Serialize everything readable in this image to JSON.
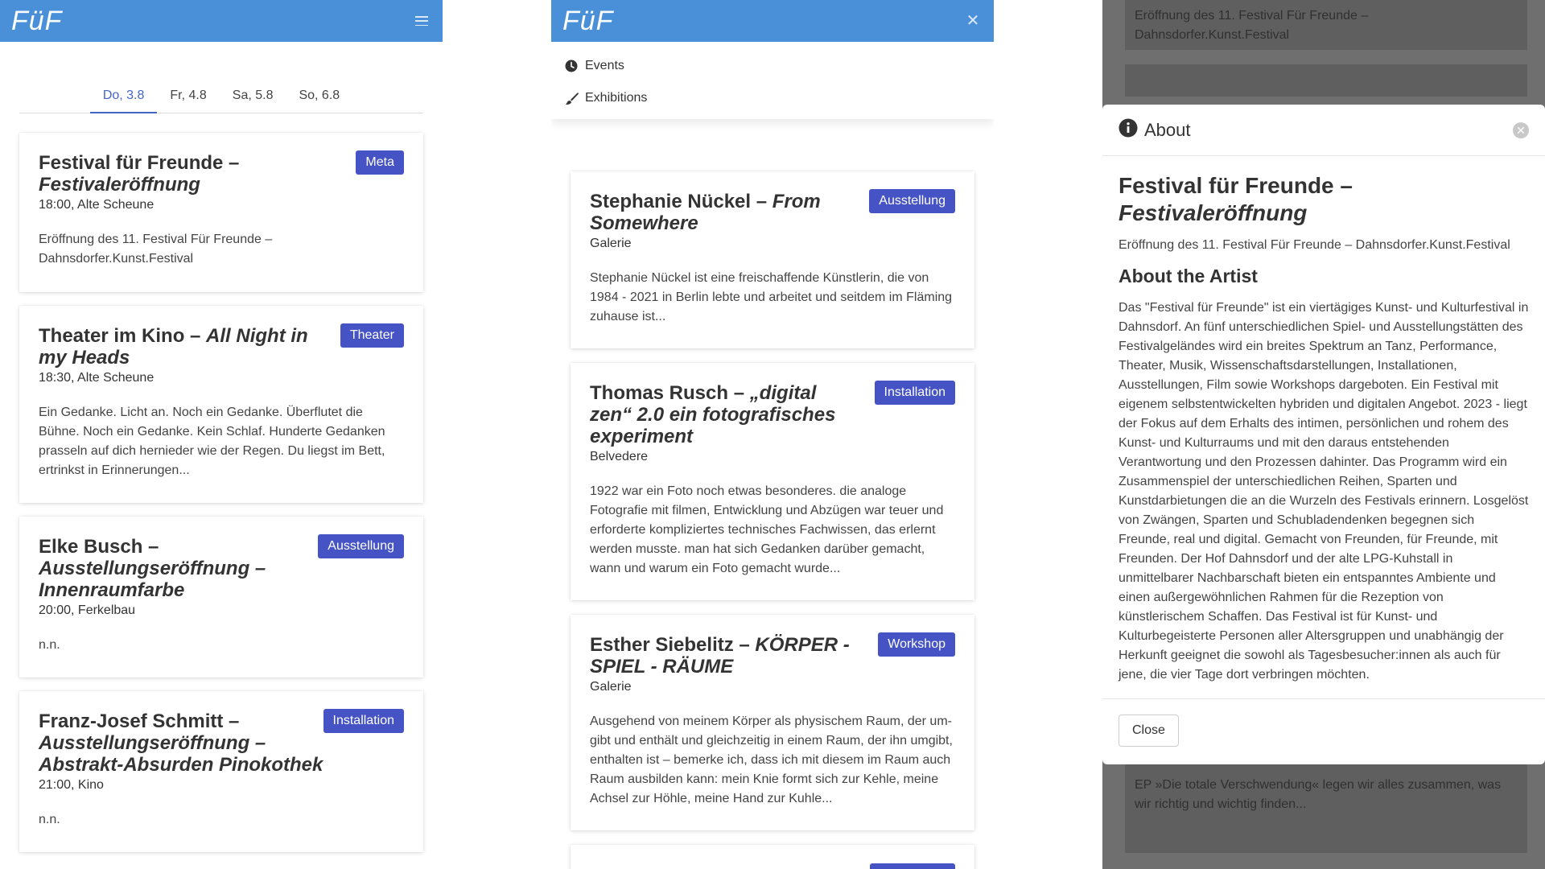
{
  "brand": {
    "logo": "FüF"
  },
  "days": [
    "Do, 3.8",
    "Fr, 4.8",
    "Sa, 5.8",
    "So, 6.8"
  ],
  "events": [
    {
      "title_main": "Festival für Freunde – ",
      "title_italic": "Festivaleröffnung",
      "meta": "18:00, Alte Scheune",
      "desc": "Eröffnung des 11. Festival Für Freunde – Dahnsdorfer.Kunst.Festival",
      "badge": "Meta"
    },
    {
      "title_main": "Theater im Kino – ",
      "title_italic": "All Night in my Heads",
      "meta": "18:30, Alte Scheune",
      "desc": "Ein Gedanke. Licht an. Noch ein Gedanke. Überflutet die Bühne. Noch ein Gedanke. Kein Schlaf. Hunderte Gedanken prasseln auf dich hernieder wie der Regen. Du liegst im Bett, ertrinkst in Erinnerungen...",
      "badge": "Theater"
    },
    {
      "title_main": "Elke Busch – ",
      "title_italic": "Ausstellungseröffnung – Innenraumfarbe",
      "meta": "20:00, Ferkelbau",
      "desc": "n.n.",
      "badge": "Ausstellung"
    },
    {
      "title_main": "Franz-Josef Schmitt – ",
      "title_italic": "Ausstellungseröffnung – Abstrakt-Absurden Pinokothek",
      "meta": "21:00, Kino",
      "desc": "n.n.",
      "badge": "Installation"
    }
  ],
  "menu": {
    "events": "Events",
    "exhibitions": "Exhibitions"
  },
  "exhibitions": [
    {
      "title_main": "Stephanie Nückel – ",
      "title_italic": "From Somewhere",
      "meta": "Galerie",
      "desc": "Stephanie Nückel ist eine freischaffende Künstlerin, die von 1984 - 2021 in Berlin lebte und arbeitet und seitdem im Fläming zuhause ist...",
      "badge": "Ausstellung"
    },
    {
      "title_main": "Thomas Rusch – ",
      "title_italic": "„digital zen“ 2.0 ein fotografisches experiment",
      "meta": "Belvedere",
      "desc": "1922 war ein Foto noch etwas besonderes. die analoge Fotografie mit filmen, Entwicklung und Abzügen war teuer und erforderte kompliziertes technisches Fachwissen, das erlernt werden musste. man hat sich Gedanken darüber gemacht, wann und warum ein Foto gemacht wurde...",
      "badge": "Installation"
    },
    {
      "title_main": "Esther Siebelitz – ",
      "title_italic": "KÖRPER - SPIEL - RÄUME",
      "meta": "Galerie",
      "desc": "Ausgehend von meinem Körper als physischem Raum, der um- gibt und enthält und gleichzeitig in einem Raum, der ihn umgibt, enthalten ist – bemerke ich, dass ich mit diesem im Raum auch Raum ausbilden kann: mein Knie formt sich zur Kehle, meine Achsel zur Höhle, meine Hand zur Kuhle...",
      "badge": "Workshop"
    }
  ],
  "background": {
    "top_text": "Eröffnung des 11. Festival Für Freunde – Dahnsdorfer.Kunst.Festival",
    "bottom_text": "EP »Die totale Verschwendung« legen wir alles zusammen, was wir richtig und wichtig finden..."
  },
  "modal": {
    "header": "About",
    "title_main": "Festival für Freunde – ",
    "title_italic": "Festivaleröffnung",
    "subtitle": "Eröffnung des 11. Festival Für Freunde – Dahnsdorfer.Kunst.Festival",
    "section_heading": "About the Artist",
    "body": "Das \"Festival für Freunde\" ist ein viertägiges Kunst- und Kulturfestival in Dahnsdorf. An fünf unterschiedlichen Spiel- und Ausstellungstätten des Festivalgeländes wird ein breites Spektrum an Tanz, Performance, Theater, Musik, Wissenschaftsdarstellungen, Installationen, Ausstellungen, Film sowie Workshops dargeboten. Ein Festival mit eigenem selbstentwickelten hybriden und digitalen Angebot. 2023 - liegt der Fokus auf dem Erhalts des intimen, persönlichen und rohem des Kunst- und Kulturraums und mit den daraus entstehenden Verantwortung und den Prozessen dahinter. Das Programm wird ein Zusammenspiel der unterschiedlichen Reihen, Sparten und Kunstdarbietungen die an die Wurzeln des Festivals erinnern. Losgelöst von Zwängen, Sparten und Schubladendenken begegnen sich Freunde, real und digital. Gemacht von Freunden, für Freunde, mit Freunden. Der Hof Dahnsdorf und der alte LPG-Kuhstall in unmittelbarer Nachbarschaft bieten ein entspanntes Ambiente und einen außergewöhnlichen Rahmen für die Rezeption von künstlerischem Schaffen. Das Festival ist für Kunst- und Kulturbegeisterte Personen aller Altersgruppen und unabhängig der Herkunft geeignet die sowohl als Tagesbesucher:innen als auch für jene, die vier Tage dort verbringen möchten.",
    "close_label": "Close"
  }
}
